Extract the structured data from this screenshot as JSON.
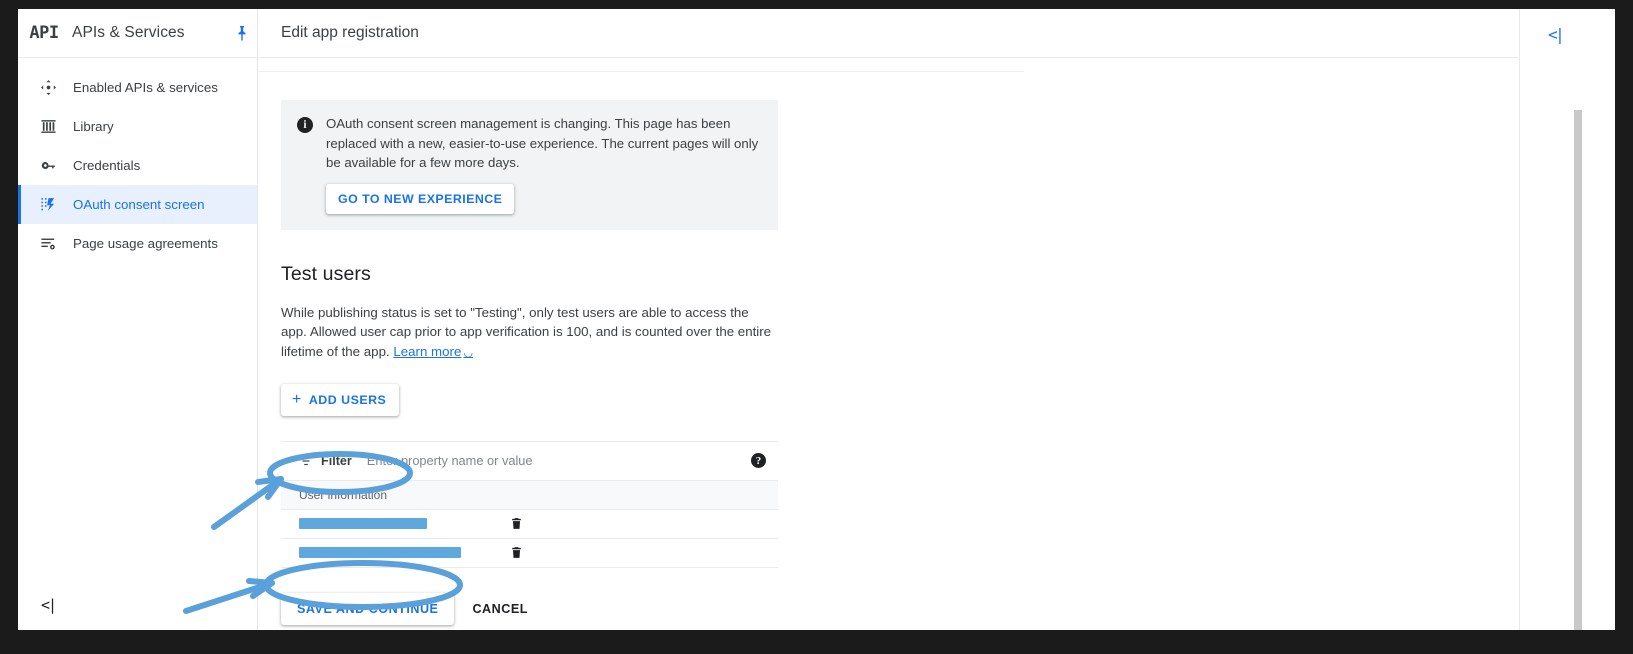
{
  "sidebar": {
    "logo_text": "API",
    "title": "APIs & Services",
    "pin_icon": "pushpin-icon",
    "collapse_icon": "collapse-panel-icon",
    "collapse_glyph": "<|",
    "items": [
      {
        "label": "Enabled APIs & services",
        "icon": "dashboard-arrows-icon",
        "active": false
      },
      {
        "label": "Library",
        "icon": "library-columns-icon",
        "active": false
      },
      {
        "label": "Credentials",
        "icon": "key-icon",
        "active": false
      },
      {
        "label": "OAuth consent screen",
        "icon": "consent-screen-icon",
        "active": true
      },
      {
        "label": "Page usage agreements",
        "icon": "page-usage-gear-icon",
        "active": false
      }
    ]
  },
  "header": {
    "title": "Edit app registration"
  },
  "notice": {
    "icon": "info-icon",
    "text": "OAuth consent screen management is changing. This page has been replaced with a new, easier-to-use experience. The current pages will only be available for a few more days.",
    "button_label": "GO TO NEW EXPERIENCE"
  },
  "test_users": {
    "heading": "Test users",
    "description_before_link": "While publishing status is set to \"Testing\", only test users are able to access the app. Allowed user cap prior to app verification is 100, and is counted over the entire lifetime of the app. ",
    "link_label": "Learn more",
    "link_external_icon": "external-link-icon",
    "add_button_label": "ADD USERS",
    "add_button_icon": "plus-icon"
  },
  "table": {
    "filter_icon": "filter-icon",
    "filter_label": "Filter",
    "filter_placeholder": "Enter property name or value",
    "filter_value": "",
    "help_icon": "help-icon",
    "column_header": "User information",
    "rows": [
      {
        "value": "",
        "redacted": true,
        "redact_width": 128,
        "delete_icon": "trash-icon"
      },
      {
        "value": "",
        "redacted": true,
        "redact_width": 162,
        "delete_icon": "trash-icon"
      }
    ]
  },
  "actions": {
    "save_label": "SAVE AND CONTINUE",
    "cancel_label": "CANCEL"
  },
  "right_rail": {
    "collapse_icon": "collapse-panel-icon",
    "collapse_glyph": "<|",
    "scrollbar": "vertical-scrollbar"
  },
  "annotations": {
    "color": "#5aa0da",
    "marks": [
      {
        "type": "ellipse",
        "target": "user-information-column-header"
      },
      {
        "type": "arrow",
        "target": "user-information-column-header"
      },
      {
        "type": "ellipse",
        "target": "save-and-continue-button"
      },
      {
        "type": "arrow",
        "target": "save-and-continue-button"
      }
    ]
  }
}
